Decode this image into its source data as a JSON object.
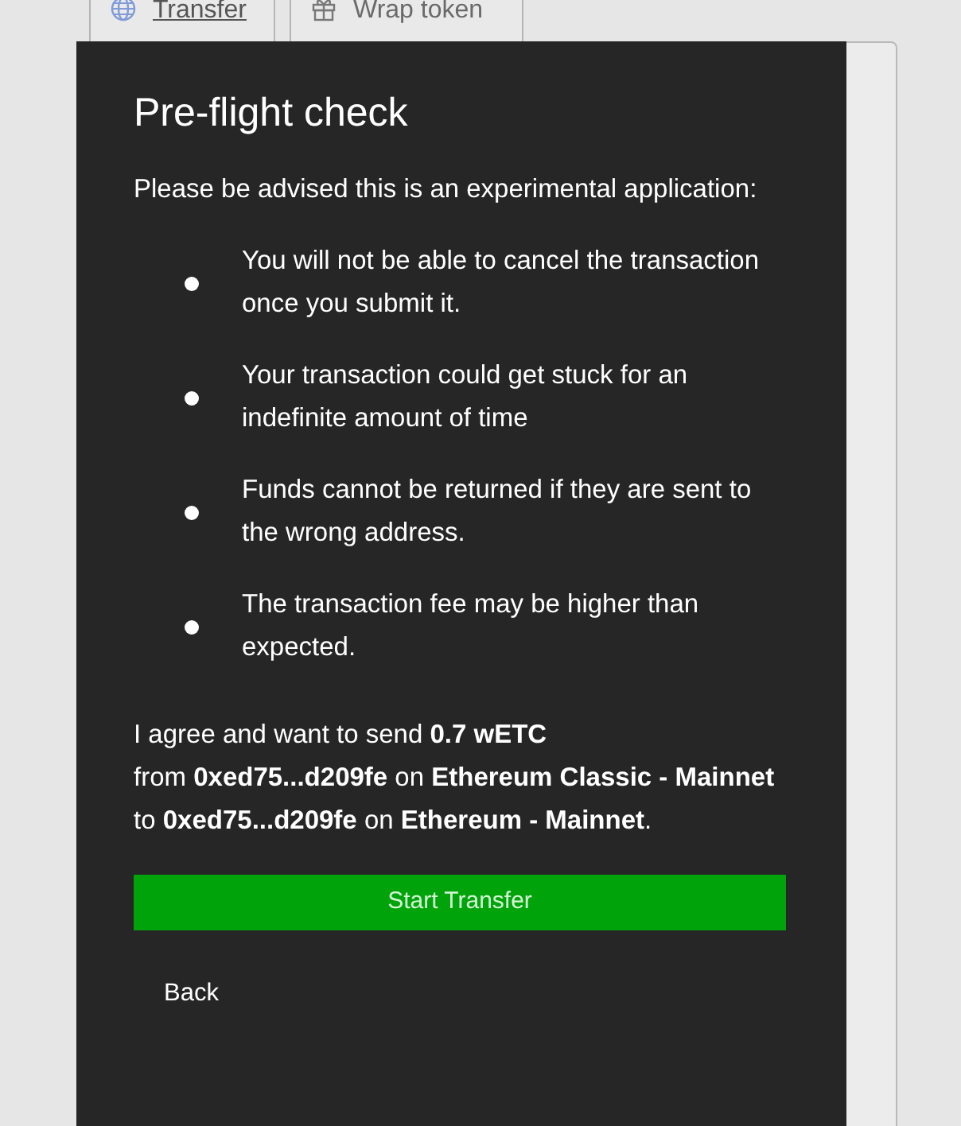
{
  "tabs": [
    {
      "label": "Transfer",
      "selected": true
    },
    {
      "label": "Wrap token",
      "selected": false
    }
  ],
  "dialog": {
    "title": "Pre-flight check",
    "intro": "Please be advised this is an experimental application:",
    "warnings": [
      "You will not be able to cancel the transaction once you submit it.",
      "Your transaction could get stuck for an indefinite amount of time",
      "Funds cannot be returned if they are sent to the wrong address.",
      "The transaction fee may be higher than expected."
    ],
    "agreement": [
      "I agree and want to send **0.7 wETC**",
      "from **0xed75...d209fe** on **Ethereum Classic - Mainnet** to **0xed75...d209fe** on **Ethereum - Mainnet**."
    ],
    "buttons": [
      {
        "label": "Start Transfer",
        "kind": "primary"
      },
      {
        "label": "Back",
        "kind": "link"
      }
    ]
  }
}
